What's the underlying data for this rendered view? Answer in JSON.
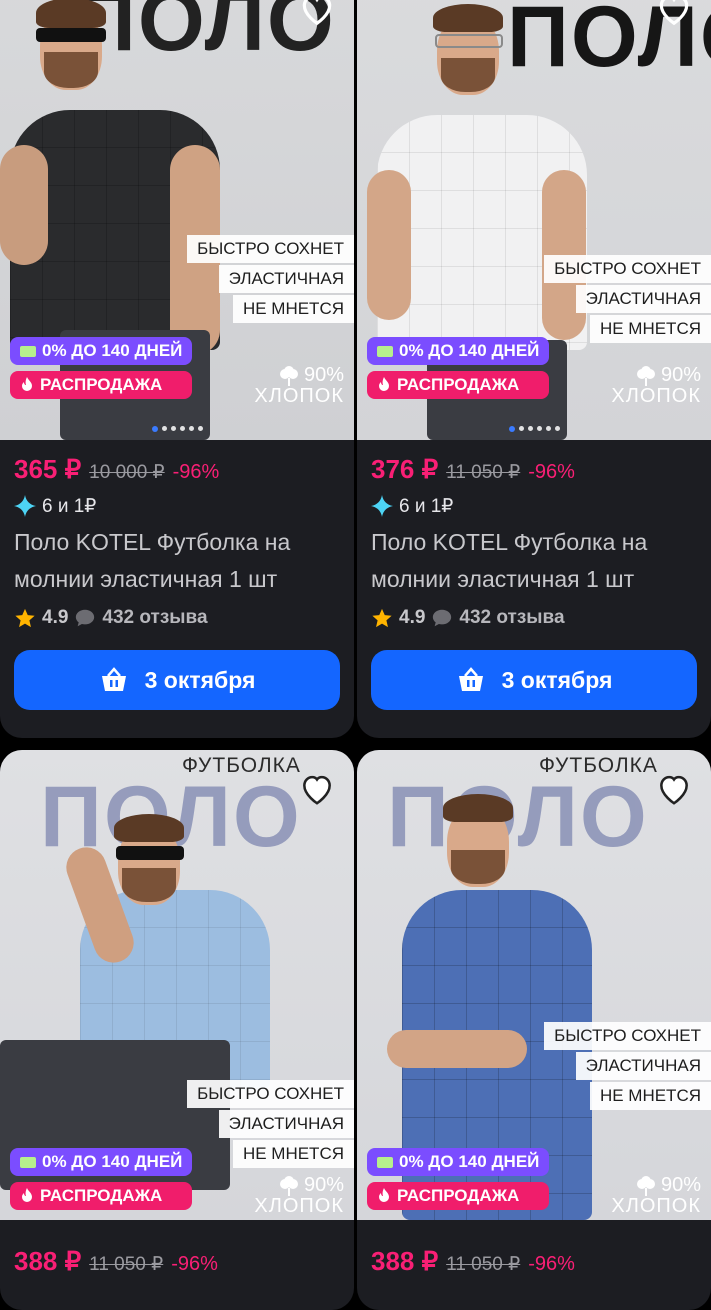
{
  "products": [
    {
      "heading": "ПОЛО",
      "subheading": "",
      "features": [
        "БЫСТРО СОХНЕТ",
        "ЭЛАСТИЧНАЯ",
        "НЕ МНЕТСЯ"
      ],
      "installment_badge": "0% ДО 140 ДНЕЙ",
      "sale_badge": "РАСПРОДАЖА",
      "cotton_pct": "90%",
      "cotton_word": "ХЛОПОК",
      "price": "365 ₽",
      "old_price": "10 000 ₽",
      "discount": "-96%",
      "bonus": "6 и 1₽",
      "title": "Поло KOTEL Футболка на молнии эластичная 1 шт",
      "rating": "4.9",
      "reviews": "432 отзыва",
      "delivery": "3 октября"
    },
    {
      "heading": "ПОЛО",
      "subheading": "",
      "features": [
        "БЫСТРО СОХНЕТ",
        "ЭЛАСТИЧНАЯ",
        "НЕ МНЕТСЯ"
      ],
      "installment_badge": "0% ДО 140 ДНЕЙ",
      "sale_badge": "РАСПРОДАЖА",
      "cotton_pct": "90%",
      "cotton_word": "ХЛОПОК",
      "price": "376 ₽",
      "old_price": "11 050 ₽",
      "discount": "-96%",
      "bonus": "6 и 1₽",
      "title": "Поло KOTEL Футболка на молнии эластичная 1 шт",
      "rating": "4.9",
      "reviews": "432 отзыва",
      "delivery": "3 октября"
    },
    {
      "heading": "ПОЛО",
      "subheading": "ФУТБОЛКА",
      "features": [
        "БЫСТРО СОХНЕТ",
        "ЭЛАСТИЧНАЯ",
        "НЕ МНЕТСЯ"
      ],
      "installment_badge": "0% ДО 140 ДНЕЙ",
      "sale_badge": "РАСПРОДАЖА",
      "cotton_pct": "90%",
      "cotton_word": "ХЛОПОК",
      "price": "388 ₽",
      "old_price": "11 050 ₽",
      "discount": "-96%"
    },
    {
      "heading": "ПОЛО",
      "subheading": "ФУТБОЛКА",
      "features": [
        "БЫСТРО СОХНЕТ",
        "ЭЛАСТИЧНАЯ",
        "НЕ МНЕТСЯ"
      ],
      "installment_badge": "0% ДО 140 ДНЕЙ",
      "sale_badge": "РАСПРОДАЖА",
      "cotton_pct": "90%",
      "cotton_word": "ХЛОПОК",
      "price": "388 ₽",
      "old_price": "11 050 ₽",
      "discount": "-96%"
    }
  ],
  "colors": {
    "accent_price": "#f91f75",
    "button": "#1466ff",
    "installment_badge": "#7b4dff",
    "sale_badge": "#f01d6b",
    "card_bg": "#1c1d22"
  },
  "icons": [
    "heart-icon",
    "card-icon",
    "fire-icon",
    "cotton-icon",
    "sparkle-icon",
    "star-icon",
    "chat-bubble-icon",
    "basket-icon"
  ]
}
